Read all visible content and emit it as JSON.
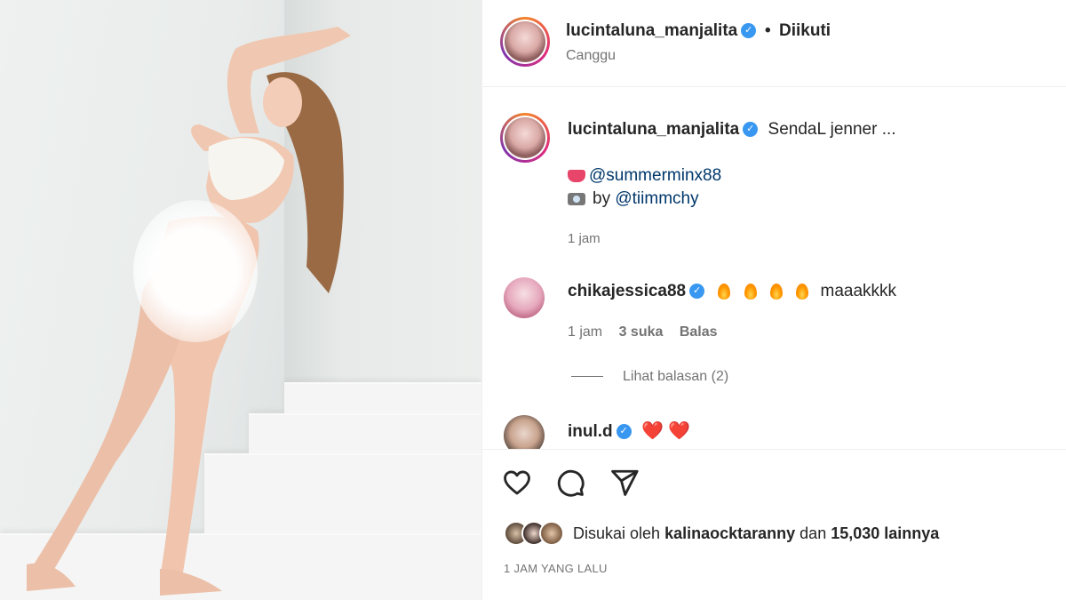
{
  "post": {
    "username": "lucintaluna_manjalita",
    "dot": "•",
    "follow_status": "Diikuti",
    "location": "Canggu"
  },
  "caption": {
    "username": "lucintaluna_manjalita",
    "text": "SendaL jenner ...",
    "tag_line1": "@summerminx88",
    "tag_line2_prefix": "by",
    "tag_line2_link": "@tiimmchy",
    "time": "1 jam"
  },
  "comments": [
    {
      "username": "chikajessica88",
      "text": "maaakkkk",
      "time": "1 jam",
      "likes": "3 suka",
      "reply": "Balas",
      "view_replies": "Lihat balasan (2)"
    },
    {
      "username": "inul.d",
      "text": "❤️ ❤️"
    }
  ],
  "footer": {
    "liked_prefix": "Disukai oleh",
    "liked_user": "kalinaocktaranny",
    "liked_and": "dan",
    "liked_count": "15,030 lainnya",
    "posted_ago": "1 JAM YANG LALU"
  },
  "icons": {
    "verified": "verified-badge-icon",
    "like": "heart-icon",
    "comment": "comment-icon",
    "share": "send-icon"
  },
  "colors": {
    "verified": "#3897f0",
    "link": "#00376b",
    "muted": "#737373"
  }
}
